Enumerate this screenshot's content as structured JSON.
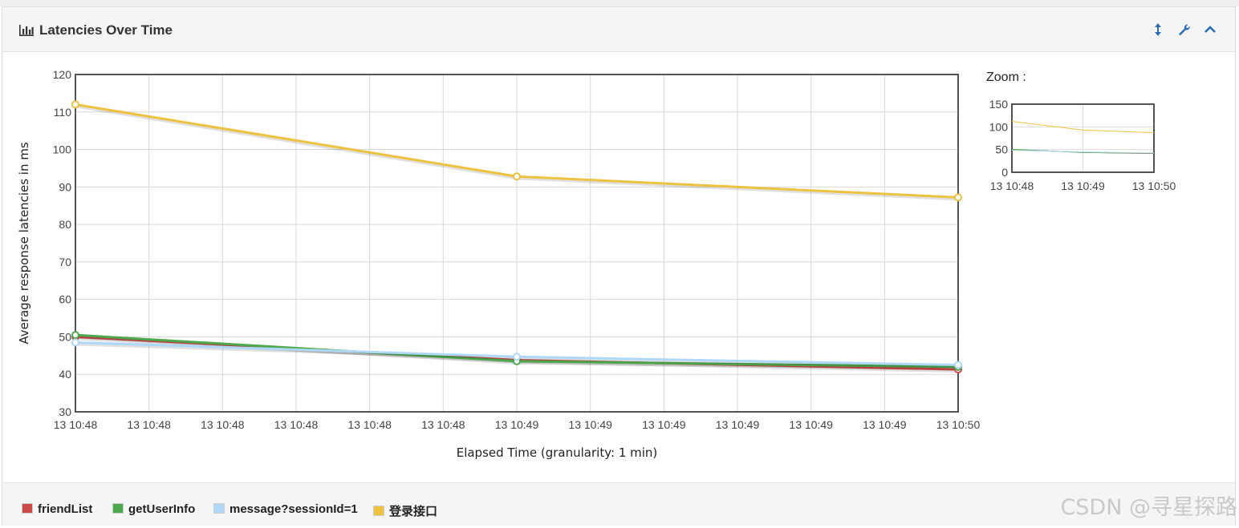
{
  "panel": {
    "title": "Latencies Over Time",
    "icons": [
      "resize-vertical-icon",
      "wrench-icon",
      "chevron-up-icon"
    ]
  },
  "chart_data": {
    "type": "line",
    "xlabel": "Elapsed Time (granularity: 1 min)",
    "ylabel": "Average response latencies in ms",
    "ylim": [
      30,
      120
    ],
    "yticks": [
      30,
      40,
      50,
      60,
      70,
      80,
      90,
      100,
      110,
      120
    ],
    "xtick_labels": [
      "13 10:48",
      "13 10:48",
      "13 10:48",
      "13 10:48",
      "13 10:48",
      "13 10:48",
      "13 10:49",
      "13 10:49",
      "13 10:49",
      "13 10:49",
      "13 10:49",
      "13 10:49",
      "13 10:50"
    ],
    "x": [
      "13 10:48",
      "13 10:49",
      "13 10:50"
    ],
    "grid": true,
    "legend_position": "bottom",
    "series": [
      {
        "name": "friendList",
        "color": "#cb4b4b",
        "values": [
          50.0,
          43.8,
          41.3
        ]
      },
      {
        "name": "getUserInfo",
        "color": "#4da74d",
        "values": [
          50.5,
          43.5,
          42.0
        ]
      },
      {
        "name": "message?sessionId=1",
        "color": "#afd8f8",
        "values": [
          48.5,
          44.7,
          42.5
        ]
      },
      {
        "name": "登录接口",
        "color": "#edc240",
        "values": [
          112.0,
          92.8,
          87.2
        ]
      }
    ]
  },
  "zoom": {
    "label": "Zoom :",
    "yticks": [
      0,
      50,
      100,
      150
    ],
    "ylim": [
      0,
      150
    ],
    "xtick_labels": [
      "13 10:48",
      "13 10:49",
      "13 10:50"
    ]
  },
  "watermark": "CSDN @寻星探路"
}
